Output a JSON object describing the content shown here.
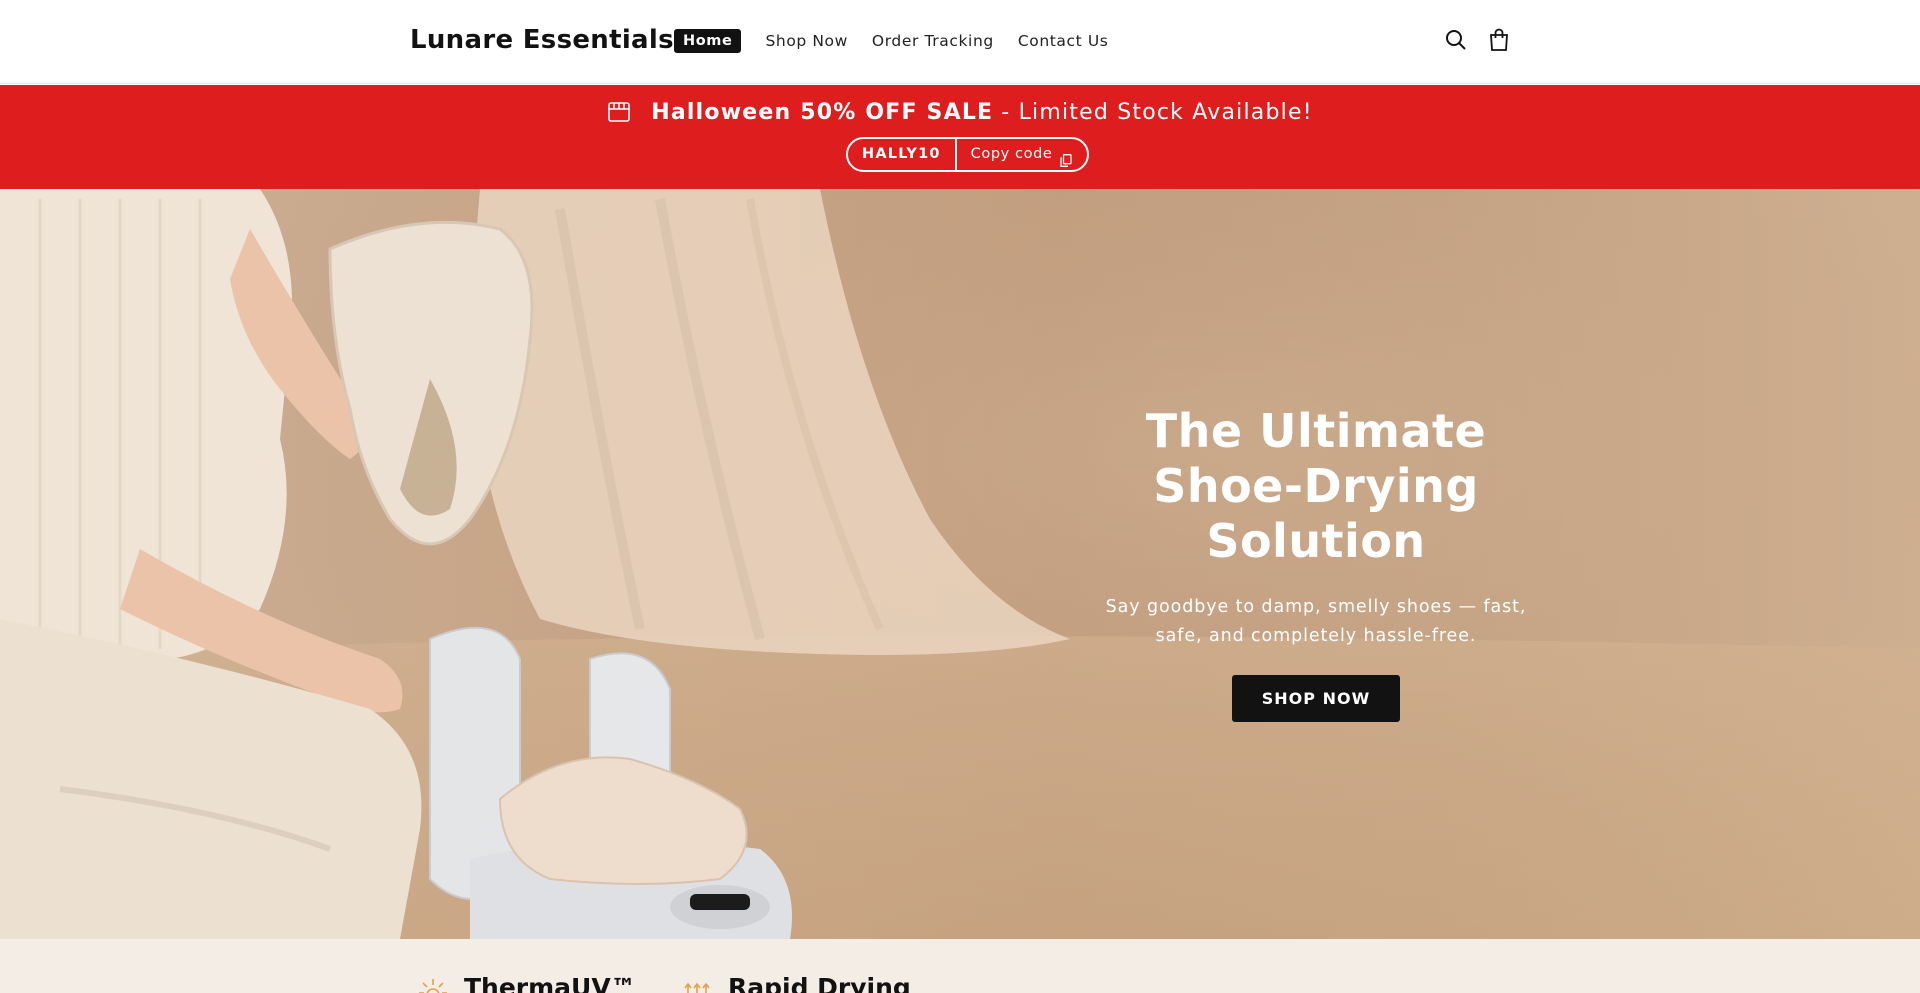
{
  "header": {
    "logo": "Lunare Essentials",
    "nav": [
      {
        "label": "Home",
        "active": true
      },
      {
        "label": "Shop Now",
        "active": false
      },
      {
        "label": "Order Tracking",
        "active": false
      },
      {
        "label": "Contact Us",
        "active": false
      }
    ],
    "icons": [
      "search-icon",
      "cart-icon"
    ]
  },
  "announcement": {
    "headline_strong": "Halloween 50% OFF SALE",
    "headline_rest": "- Limited Stock Available!",
    "code": "HALLY10",
    "copy_label": "Copy code",
    "background_color": "#dd1d1e"
  },
  "hero": {
    "title": "The Ultimate Shoe-Drying Solution",
    "subtitle": "Say goodbye to damp, smelly shoes — fast, safe, and completely hassle-free.",
    "button_label": "SHOP NOW",
    "button_color": "#121212"
  },
  "features": [
    {
      "title": "ThermaUV™",
      "icon": "sun-icon"
    },
    {
      "title": "Rapid Drying",
      "icon": "heat-arrows-icon"
    }
  ]
}
